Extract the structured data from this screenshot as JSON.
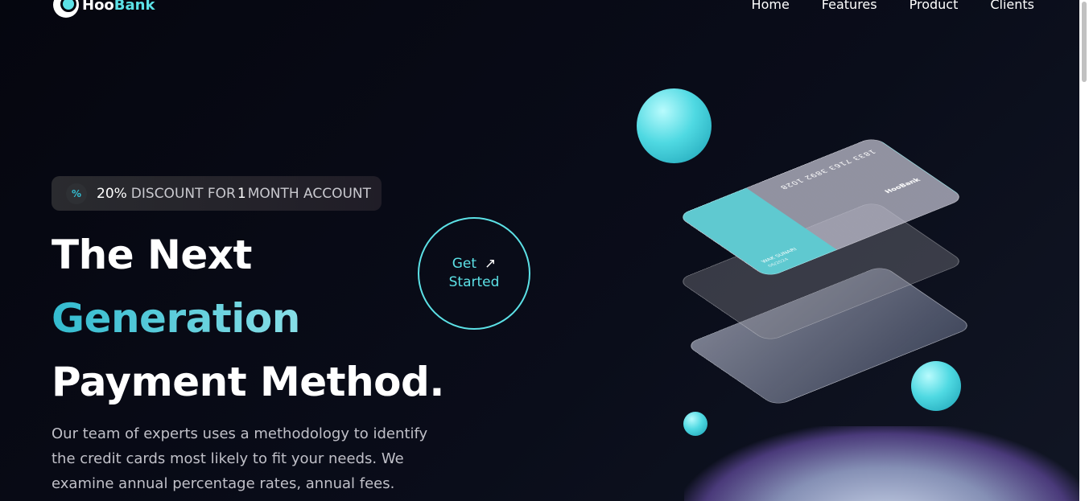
{
  "brand": {
    "name_part1": "Hoo",
    "name_part2": "Bank"
  },
  "nav": {
    "items": [
      "Home",
      "Features",
      "Product",
      "Clients"
    ]
  },
  "badge": {
    "icon": "discount-icon",
    "percent": "20%",
    "text1": "DISCOUNT FOR",
    "highlight": "1",
    "text2": "MONTH ACCOUNT"
  },
  "hero": {
    "line1": "The Next",
    "line2": "Generation",
    "line3": "Payment Method.",
    "description": "Our team of experts uses a methodology to identify the credit cards most likely to fit your needs. We examine annual percentage rates, annual fees."
  },
  "cta": {
    "line1": "Get",
    "line2": "Started",
    "icon": "arrow-up-right-icon"
  },
  "card": {
    "number": "1833 7163 3892 1028",
    "holder": "WAK SUNARI",
    "expiry": "06/2024",
    "brand": "HooBank"
  },
  "colors": {
    "accent": "#5ce1e6",
    "background": "#05060f"
  }
}
